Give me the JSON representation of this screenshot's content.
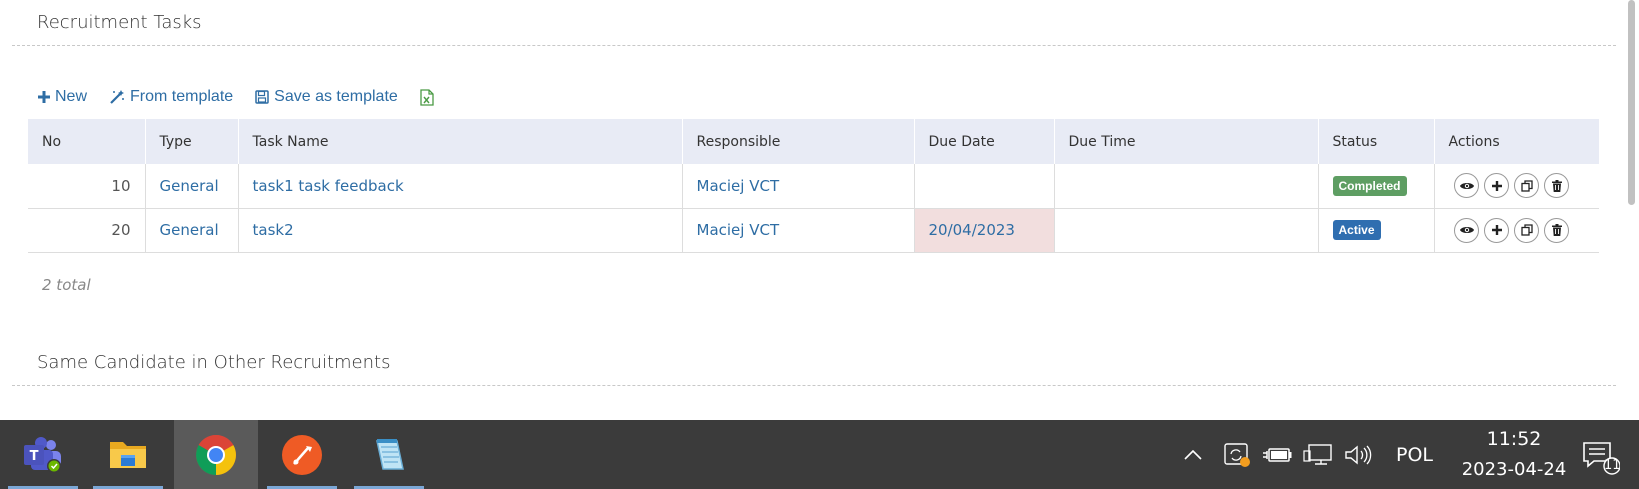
{
  "sections": {
    "recruitment_tasks": "Recruitment Tasks",
    "same_candidate": "Same Candidate in Other Recruitments"
  },
  "toolbar": {
    "new_label": "New",
    "from_template_label": "From template",
    "save_as_template_label": "Save as template"
  },
  "table": {
    "headers": [
      "No",
      "Type",
      "Task Name",
      "Responsible",
      "Due Date",
      "Due Time",
      "Status",
      "Actions"
    ],
    "rows": [
      {
        "no": "10",
        "type": "General",
        "task_name": "task1 task feedback",
        "responsible": "Maciej VCT",
        "due_date": "",
        "due_time": "",
        "status": "Completed"
      },
      {
        "no": "20",
        "type": "General",
        "task_name": "task2",
        "responsible": "Maciej VCT",
        "due_date": "20/04/2023",
        "due_time": "",
        "status": "Active"
      }
    ],
    "total": "2 total"
  },
  "taskbar": {
    "language": "POL",
    "time": "11:52",
    "date": "2023-04-24",
    "notification_count": "11"
  },
  "colors": {
    "link": "#2e6da4",
    "completed_badge": "#5e9e63",
    "active_badge": "#2f6eb0",
    "overdue_bg": "#f2dede",
    "header_bg": "#e8ebf5",
    "taskbar_bg": "#3b3b3b"
  }
}
